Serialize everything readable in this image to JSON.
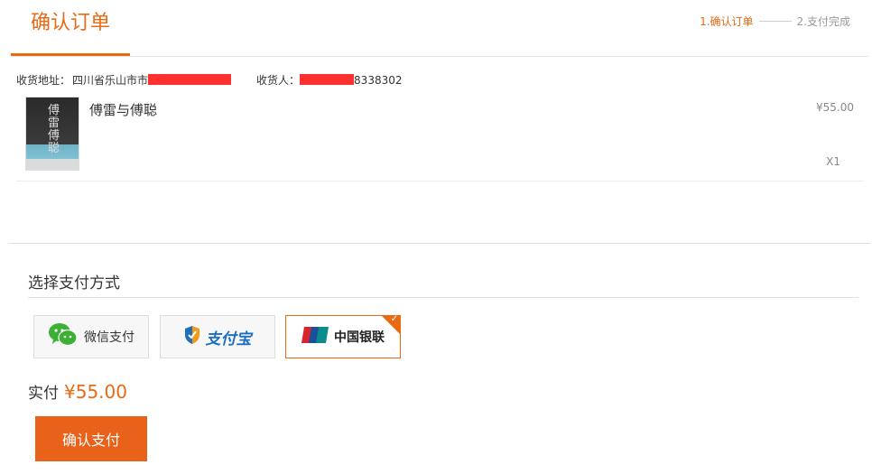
{
  "header": {
    "title": "确认订单",
    "steps": [
      {
        "label": "1.确认订单",
        "active": true
      },
      {
        "label": "2.支付完成",
        "active": false
      }
    ]
  },
  "order": {
    "address_label": "收货地址：",
    "address_value": "四川省乐山市市",
    "receiver_label": "收货人：",
    "receiver_phone": "8338302"
  },
  "item": {
    "name": "傅雷与傅聪",
    "price": "¥55.00",
    "quantity": "X1",
    "cover_glyph": "傅雷傅聪"
  },
  "payment": {
    "section_title": "选择支付方式",
    "options": [
      {
        "label": "微信支付",
        "icon": "wechat-icon",
        "selected": false
      },
      {
        "label": "支付宝",
        "icon": "alipay-shield-icon",
        "selected": false
      },
      {
        "label": "中国银联",
        "icon": "unionpay-icon",
        "selected": true
      }
    ]
  },
  "total": {
    "label": "实付",
    "value": "¥55.00"
  },
  "actions": {
    "confirm_label": "确认支付"
  },
  "colors": {
    "accent": "#e86a15",
    "redaction": "#ff3030",
    "wechat_green": "#3cb034",
    "alipay_blue": "#1f6fbd",
    "union_red": "#d7262e"
  }
}
